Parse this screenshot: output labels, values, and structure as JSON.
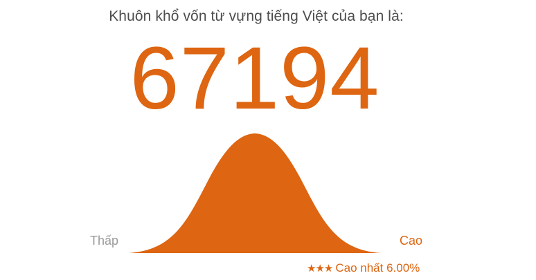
{
  "result": {
    "headline": "Khuôn khổ vốn từ vựng tiếng Việt của bạn là:",
    "score": "67194"
  },
  "scale": {
    "low_label": "Thấp",
    "high_label": "Cao"
  },
  "rank": {
    "stars": "★★★",
    "text": "Cao nhất 6.00%"
  },
  "colors": {
    "accent": "#de6511",
    "headline": "#4d4d4d",
    "muted": "#9a9a9a"
  },
  "icons": {
    "distribution": "bell-curve-icon",
    "rank": "star-icon"
  }
}
